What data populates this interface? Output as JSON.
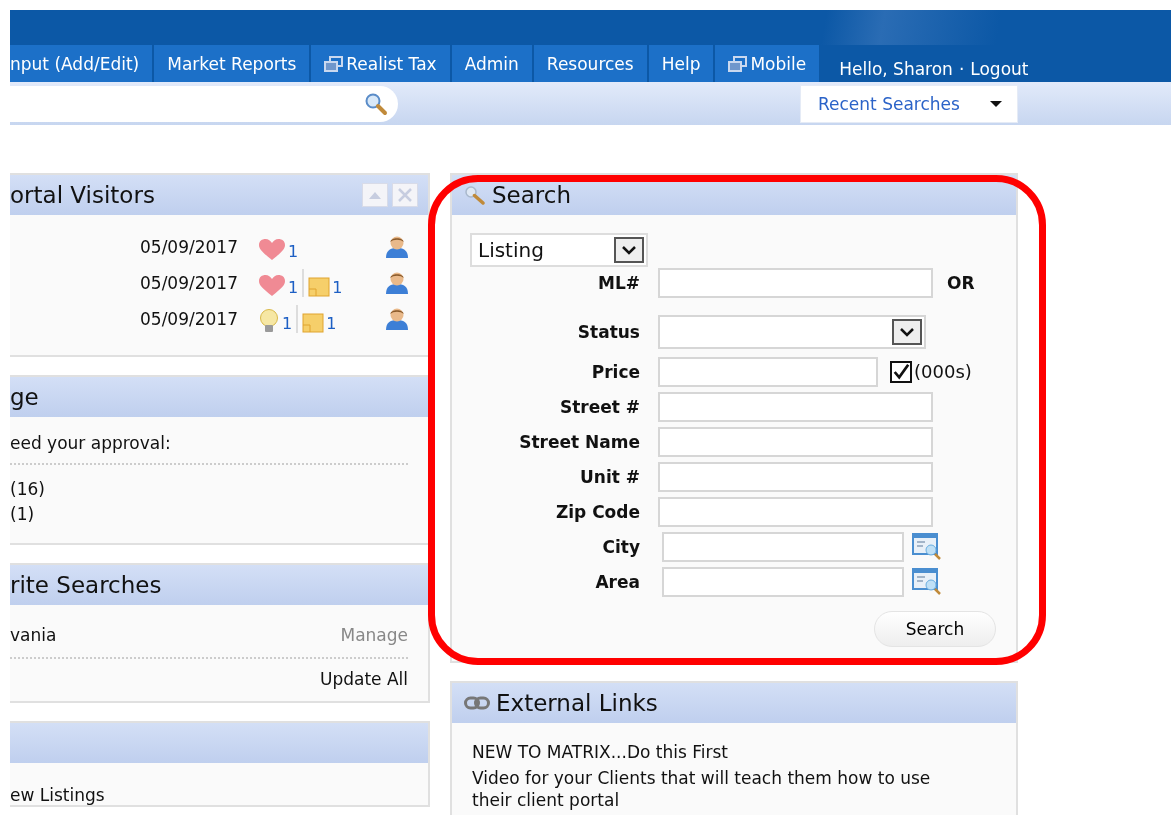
{
  "nav": {
    "tabs": [
      {
        "label": "nput (Add/Edit)",
        "kind": "plain"
      },
      {
        "label": "Market Reports",
        "kind": "plain"
      },
      {
        "label": "Realist Tax",
        "kind": "popup"
      },
      {
        "label": "Admin",
        "kind": "plain"
      },
      {
        "label": "Resources",
        "kind": "plain"
      },
      {
        "label": "Help",
        "kind": "plain"
      },
      {
        "label": "Mobile",
        "kind": "popup"
      }
    ],
    "greeting": "Hello, Sharon",
    "separator": "·",
    "logout": "Logout"
  },
  "toolbar": {
    "recent_searches": "Recent Searches"
  },
  "portal_visitors": {
    "title": "ortal Visitors",
    "rows": [
      {
        "date": "05/09/2017",
        "activities": [
          {
            "kind": "heart",
            "count": "1"
          }
        ]
      },
      {
        "date": "05/09/2017",
        "activities": [
          {
            "kind": "heart",
            "count": "1"
          },
          {
            "kind": "note",
            "count": "1"
          }
        ]
      },
      {
        "date": "05/09/2017",
        "activities": [
          {
            "kind": "bulb",
            "count": "1"
          },
          {
            "kind": "note",
            "count": "1"
          }
        ]
      }
    ]
  },
  "messages": {
    "title": "ge",
    "intro": "eed your approval:",
    "items": [
      "(16)",
      "(1)"
    ]
  },
  "favorite_searches": {
    "title": "rite Searches",
    "items": [
      {
        "name": "vania",
        "action": "Manage"
      }
    ],
    "update": "Update All"
  },
  "listings_panel": {
    "items": [
      "ew Listings"
    ]
  },
  "search": {
    "title": "Search",
    "type": "Listing",
    "fields": [
      {
        "label": "ML#",
        "kind": "text",
        "suffix": "OR"
      },
      {
        "label": "Status",
        "kind": "select"
      },
      {
        "label": "Price",
        "kind": "price",
        "checked": true,
        "option": "(000s)"
      },
      {
        "label": "Street #",
        "kind": "text"
      },
      {
        "label": "Street Name",
        "kind": "text"
      },
      {
        "label": "Unit #",
        "kind": "text"
      },
      {
        "label": "Zip Code",
        "kind": "text"
      },
      {
        "label": "City",
        "kind": "lookup"
      },
      {
        "label": "Area",
        "kind": "lookup"
      }
    ],
    "button": "Search"
  },
  "external_links": {
    "title": "External Links",
    "items": [
      "NEW TO MATRIX...Do this First",
      "Video for your Clients that will teach them how to use their client portal"
    ]
  }
}
